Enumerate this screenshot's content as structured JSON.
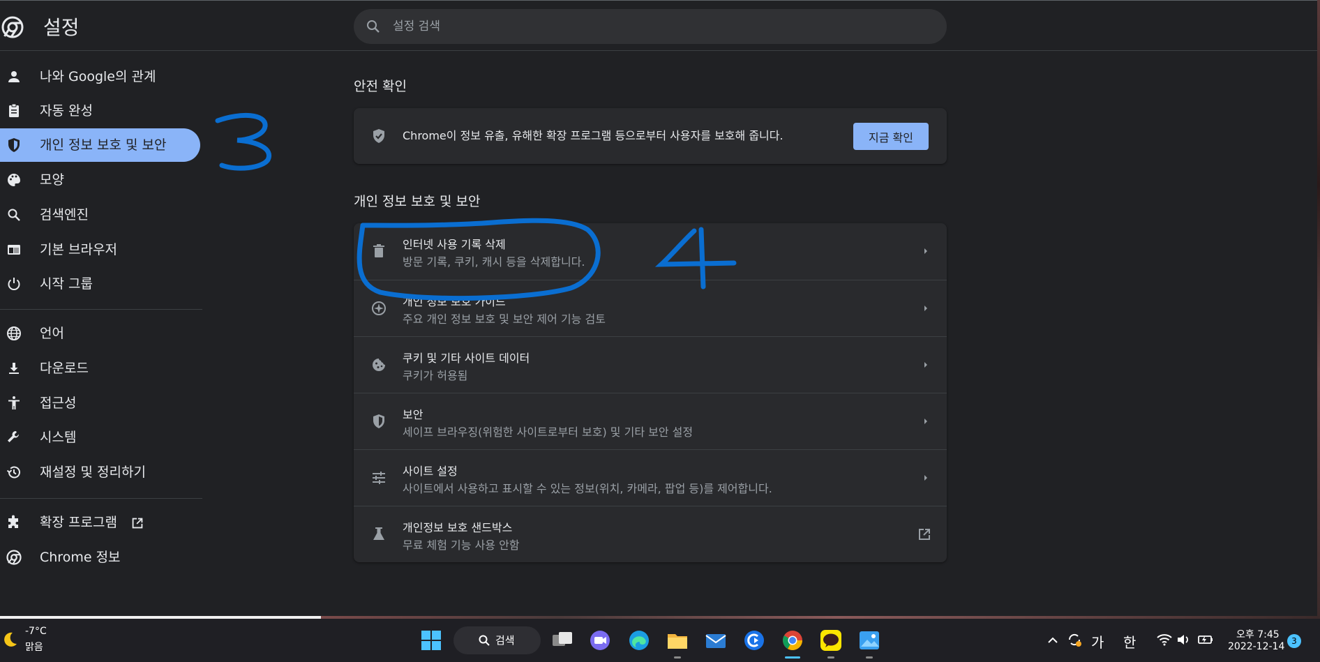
{
  "app": {
    "title": "설정"
  },
  "search": {
    "placeholder": "설정 검색"
  },
  "sidebar": {
    "items": [
      {
        "label": "나와 Google의 관계",
        "icon": "person-icon"
      },
      {
        "label": "자동 완성",
        "icon": "clipboard-icon"
      },
      {
        "label": "개인 정보 보호 및 보안",
        "icon": "shield-icon",
        "active": true
      },
      {
        "label": "모양",
        "icon": "palette-icon"
      },
      {
        "label": "검색엔진",
        "icon": "search-icon"
      },
      {
        "label": "기본 브라우저",
        "icon": "browser-icon"
      },
      {
        "label": "시작 그룹",
        "icon": "power-icon"
      },
      {
        "label": "언어",
        "icon": "globe-icon"
      },
      {
        "label": "다운로드",
        "icon": "download-icon"
      },
      {
        "label": "접근성",
        "icon": "accessibility-icon"
      },
      {
        "label": "시스템",
        "icon": "wrench-icon"
      },
      {
        "label": "재설정 및 정리하기",
        "icon": "restore-icon"
      },
      {
        "label": "확장 프로그램",
        "icon": "puzzle-icon"
      },
      {
        "label": "Chrome 정보",
        "icon": "chrome-icon"
      }
    ]
  },
  "safety_check": {
    "title": "안전 확인",
    "description": "Chrome이 정보 유출, 유해한 확장 프로그램 등으로부터 사용자를 보호해 줍니다.",
    "button_label": "지금 확인"
  },
  "privacy": {
    "title": "개인 정보 보호 및 보안",
    "rows": [
      {
        "title": "인터넷 사용 기록 삭제",
        "subtitle": "방문 기록, 쿠키, 캐시 등을 삭제합니다.",
        "icon": "trash-icon"
      },
      {
        "title": "개인 정보 보호 가이드",
        "subtitle": "주요 개인 정보 보호 및 보안 제어 기능 검토",
        "icon": "compass-icon"
      },
      {
        "title": "쿠키 및 기타 사이트 데이터",
        "subtitle": "쿠키가 허용됨",
        "icon": "cookie-icon"
      },
      {
        "title": "보안",
        "subtitle": "세이프 브라우징(위험한 사이트로부터 보호) 및 기타 보안 설정",
        "icon": "shield-icon"
      },
      {
        "title": "사이트 설정",
        "subtitle": "사이트에서 사용하고 표시할 수 있는 정보(위치, 카메라, 팝업 등)를 제어합니다.",
        "icon": "sliders-icon"
      },
      {
        "title": "개인정보 보호 샌드박스",
        "subtitle": "무료 체험 기능 사용 안함",
        "icon": "flask-icon"
      }
    ]
  },
  "taskbar": {
    "weather_temp": "-7°C",
    "weather_desc": "맑음",
    "search_label": "검색",
    "ime_1": "가",
    "ime_2": "한",
    "time": "오후 7:45",
    "date": "2022-12-14",
    "notification_count": "3"
  },
  "colors": {
    "accent": "#8ab4f8",
    "background": "#202124",
    "card": "#292a2d",
    "annotation": "#0a6ed1"
  }
}
